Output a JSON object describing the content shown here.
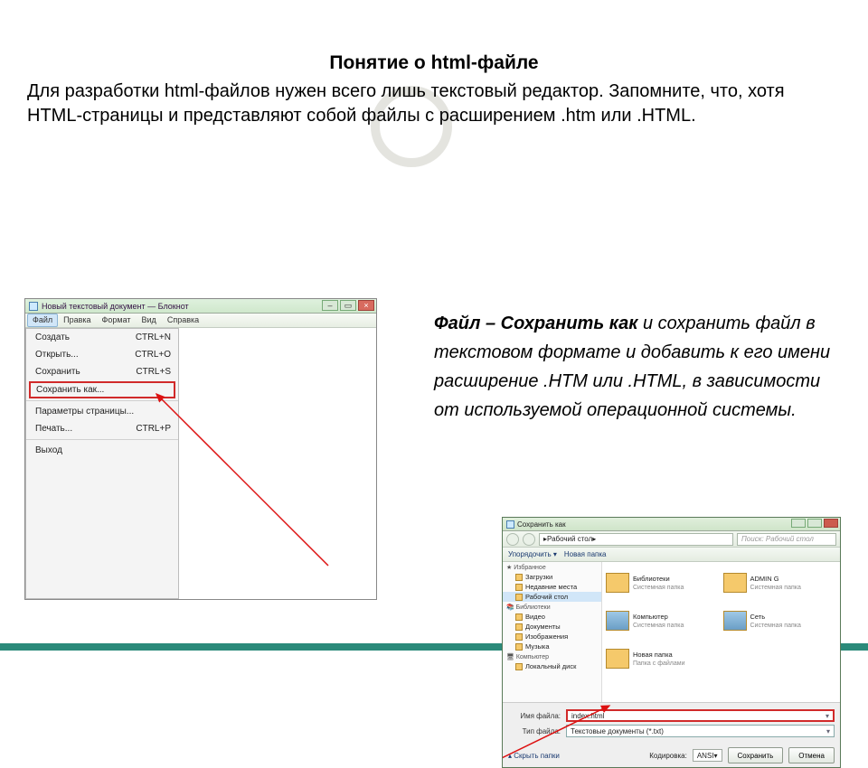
{
  "title": "Понятие о html-файле",
  "intro": "Для разработки html-файлов нужен всего лишь текстовый редактор. Запомните, что, хотя HTML-страницы и представляют собой файлы с расширением .htm или .HTML.",
  "instruction_prefix": "Файл – Сохранить как",
  "instruction_rest": " и сохранить файл в текстовом формате и добавить к его имени расширение .HTM или .HTML, в зависимости от используемой операционной системы.",
  "notepad": {
    "title": "Новый текстовый документ — Блокнот",
    "menubar": [
      "Файл",
      "Правка",
      "Формат",
      "Вид",
      "Справка"
    ],
    "menu": {
      "items": [
        {
          "label": "Создать",
          "shortcut": "CTRL+N"
        },
        {
          "label": "Открыть...",
          "shortcut": "CTRL+O"
        },
        {
          "label": "Сохранить",
          "shortcut": "CTRL+S"
        }
      ],
      "highlight": {
        "label": "Сохранить как..."
      },
      "items2": [
        {
          "label": "Параметры страницы...",
          "shortcut": ""
        },
        {
          "label": "Печать...",
          "shortcut": "CTRL+P"
        }
      ],
      "exit": {
        "label": "Выход"
      }
    }
  },
  "save": {
    "title": "Сохранить как",
    "path_label": "Рабочий стол",
    "search_placeholder": "Поиск: Рабочий стол",
    "toolbar": [
      "Упорядочить ▾",
      "Новая папка"
    ],
    "sidebar": {
      "fav_header": "Избранное",
      "favs": [
        "Загрузки",
        "Недавние места",
        "Рабочий стол"
      ],
      "lib_header": "Библиотеки",
      "libs": [
        "Видео",
        "Документы",
        "Изображения",
        "Музыка"
      ],
      "comp_header": "Компьютер",
      "comp": [
        "Локальный диск"
      ]
    },
    "items": [
      {
        "name": "Библиотеки",
        "sub": "Системная папка"
      },
      {
        "name": "ADMIN G",
        "sub": "Системная папка"
      },
      {
        "name": "Компьютер",
        "sub": "Системная папка",
        "pc": true
      },
      {
        "name": "Сеть",
        "sub": "Системная папка"
      },
      {
        "name": "Новая папка",
        "sub": "Папка с файлами"
      }
    ],
    "filename_label": "Имя файла:",
    "filename_value": "index.html",
    "filetype_label": "Тип файла:",
    "filetype_value": "Текстовые документы (*.txt)",
    "hide_folders": "Скрыть папки",
    "encoding_label": "Кодировка:",
    "encoding_value": "ANSI",
    "save_btn": "Сохранить",
    "cancel_btn": "Отмена"
  }
}
